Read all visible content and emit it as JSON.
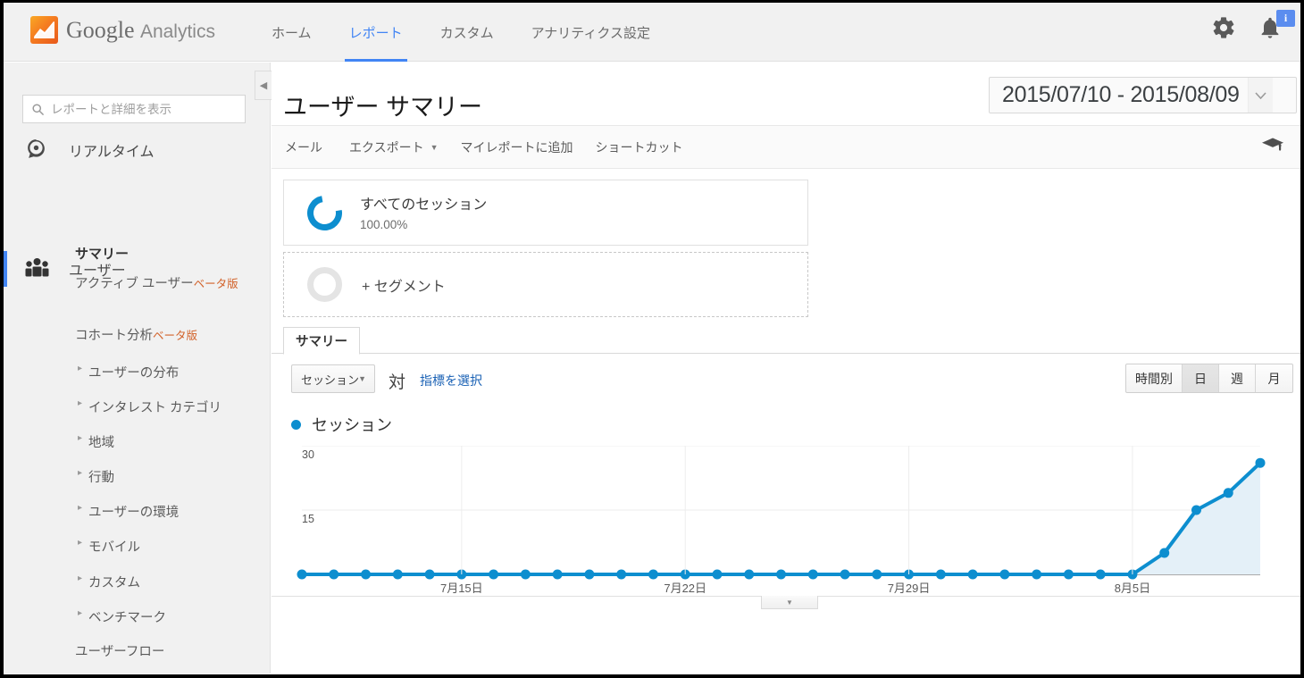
{
  "brand": {
    "google": "Google",
    "analytics": "Analytics",
    "logo_icon": "analytics-logo-icon"
  },
  "nav": {
    "tabs": [
      {
        "label": "ホーム",
        "active": false
      },
      {
        "label": "レポート",
        "active": true
      },
      {
        "label": "カスタム",
        "active": false
      },
      {
        "label": "アナリティクス設定",
        "active": false
      }
    ]
  },
  "top_icons": {
    "settings": "gear-icon",
    "notifications": "bell-icon",
    "badge": "i"
  },
  "sidebar": {
    "search_placeholder": "レポートと詳細を表示",
    "search_value": "",
    "groups": [
      {
        "label": "リアルタイム",
        "icon": "realtime-icon",
        "active": false
      },
      {
        "label": "ユーザー",
        "icon": "users-icon",
        "active": true
      }
    ],
    "items": [
      {
        "label": "サマリー",
        "bold": true,
        "caret": false,
        "badge": ""
      },
      {
        "label": "アクティブ ユーザー",
        "bold": false,
        "caret": false,
        "badge": "ベータ版"
      },
      {
        "label": "コホート分析",
        "bold": false,
        "caret": false,
        "badge": "ベータ版"
      },
      {
        "label": "ユーザーの分布",
        "bold": false,
        "caret": true,
        "badge": ""
      },
      {
        "label": "インタレスト カテゴリ",
        "bold": false,
        "caret": true,
        "badge": ""
      },
      {
        "label": "地域",
        "bold": false,
        "caret": true,
        "badge": ""
      },
      {
        "label": "行動",
        "bold": false,
        "caret": true,
        "badge": ""
      },
      {
        "label": "ユーザーの環境",
        "bold": false,
        "caret": true,
        "badge": ""
      },
      {
        "label": "モバイル",
        "bold": false,
        "caret": true,
        "badge": ""
      },
      {
        "label": "カスタム",
        "bold": false,
        "caret": true,
        "badge": ""
      },
      {
        "label": "ベンチマーク",
        "bold": false,
        "caret": true,
        "badge": ""
      },
      {
        "label": "ユーザーフロー",
        "bold": false,
        "caret": false,
        "badge": ""
      }
    ],
    "collapse_icon": "collapse-left-icon"
  },
  "header": {
    "title": "ユーザー サマリー",
    "date_range": "2015/07/10 - 2015/08/09",
    "date_range_icon": "chevron-down-icon"
  },
  "toolbar": {
    "actions": [
      {
        "label": "メール",
        "caret": false
      },
      {
        "label": "エクスポート",
        "caret": true
      },
      {
        "label": "マイレポートに追加",
        "caret": false
      },
      {
        "label": "ショートカット",
        "caret": false
      }
    ],
    "help_icon": "graduation-cap-icon"
  },
  "segments": [
    {
      "name": "すべてのセッション",
      "percent": "100.00%",
      "state": "filled"
    },
    {
      "name": "+ セグメント",
      "percent": "",
      "state": "empty"
    }
  ],
  "report_tabs": [
    {
      "label": "サマリー",
      "active": true
    }
  ],
  "chart_controls": {
    "metric_select": "セッション",
    "metric_select_icon": "chevron-down-icon",
    "versus": "対",
    "pick_metric": "指標を選択",
    "granularity": [
      {
        "label": "時間別",
        "active": false
      },
      {
        "label": "日",
        "active": true
      },
      {
        "label": "週",
        "active": false
      },
      {
        "label": "月",
        "active": false
      }
    ]
  },
  "expand_toggle_icon": "chevron-down-icon",
  "colors": {
    "accent": "#4285f4",
    "chart_line": "#0d8ecf",
    "chart_fill": "#e4f0f8",
    "beta_badge": "#d2622a",
    "link": "#1b62b5"
  },
  "chart_data": {
    "type": "line",
    "title": "セッション",
    "xlabel": "",
    "ylabel": "",
    "ylim": [
      0,
      30
    ],
    "yticks": [
      30,
      15
    ],
    "grid": true,
    "legend": [
      "セッション"
    ],
    "legend_position": "top-left",
    "x_tick_labels": [
      {
        "index": 5,
        "label": "7月15日"
      },
      {
        "index": 12,
        "label": "7月22日"
      },
      {
        "index": 19,
        "label": "7月29日"
      },
      {
        "index": 26,
        "label": "8月5日"
      }
    ],
    "categories": [
      "7月10日",
      "7月11日",
      "7月12日",
      "7月13日",
      "7月14日",
      "7月15日",
      "7月16日",
      "7月17日",
      "7月18日",
      "7月19日",
      "7月20日",
      "7月21日",
      "7月22日",
      "7月23日",
      "7月24日",
      "7月25日",
      "7月26日",
      "7月27日",
      "7月28日",
      "7月29日",
      "7月30日",
      "7月31日",
      "8月1日",
      "8月2日",
      "8月3日",
      "8月4日",
      "8月5日",
      "8月6日",
      "8月7日",
      "8月8日",
      "8月9日"
    ],
    "series": [
      {
        "name": "セッション",
        "values": [
          0,
          0,
          0,
          0,
          0,
          0,
          0,
          0,
          0,
          0,
          0,
          0,
          0,
          0,
          0,
          0,
          0,
          0,
          0,
          0,
          0,
          0,
          0,
          0,
          0,
          0,
          0,
          5,
          15,
          19,
          26
        ]
      }
    ]
  }
}
